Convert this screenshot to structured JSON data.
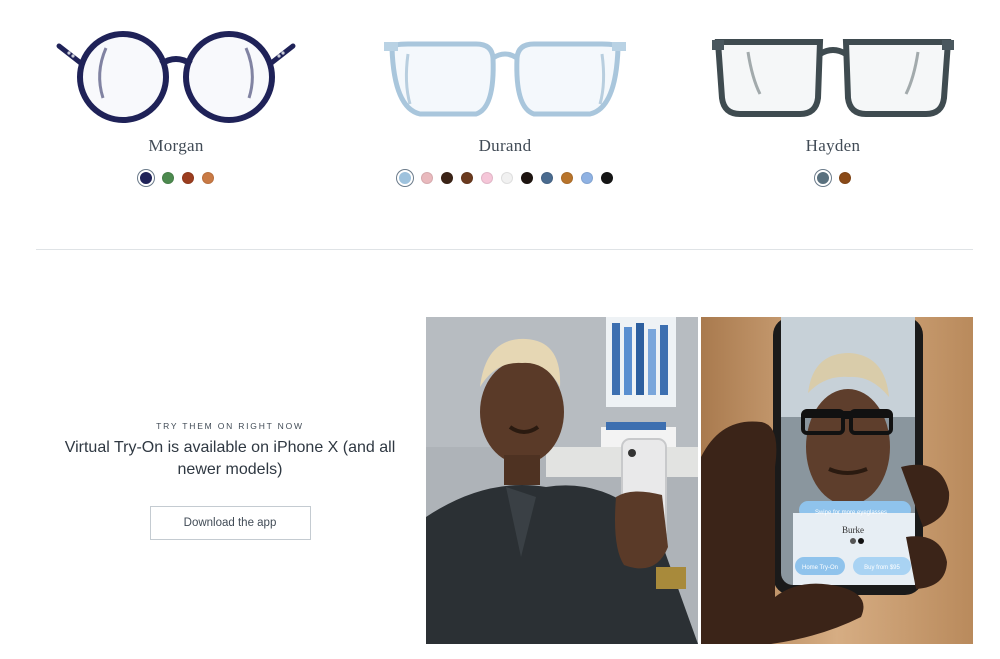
{
  "products": [
    {
      "name": "Morgan",
      "swatches": [
        {
          "color": "#1f2258",
          "selected": true
        },
        {
          "color": "#4d8a4f"
        },
        {
          "color": "#9b3d1f"
        },
        {
          "color": "#c97a45"
        }
      ]
    },
    {
      "name": "Durand",
      "swatches": [
        {
          "color": "#9ec2dd",
          "selected": true
        },
        {
          "color": "#e9b9bd"
        },
        {
          "color": "#3b2316"
        },
        {
          "color": "#6b3a1e"
        },
        {
          "color": "#f5c6d8"
        },
        {
          "color": "#f1f1f1"
        },
        {
          "color": "#1d1410"
        },
        {
          "color": "#4a6b8f"
        },
        {
          "color": "#b8742b"
        },
        {
          "color": "#8fb2e3"
        },
        {
          "color": "#151515"
        }
      ]
    },
    {
      "name": "Hayden",
      "swatches": [
        {
          "color": "#59707e",
          "selected": true
        },
        {
          "color": "#8a4a18"
        }
      ]
    }
  ],
  "tryon": {
    "eyebrow": "TRY THEM ON RIGHT NOW",
    "headline": "Virtual Try-On is available on iPhone X (and all newer models)",
    "button_label": "Download the app"
  },
  "phone_screen": {
    "hint": "Swipe for more eyeglasses",
    "frame_name": "Burke",
    "left_button": "Home Try-On",
    "right_button": "Buy from $95"
  },
  "colors": {
    "text": "#414b56",
    "divider": "#dfe3e6",
    "accent_blue": "#8fc3ec"
  }
}
